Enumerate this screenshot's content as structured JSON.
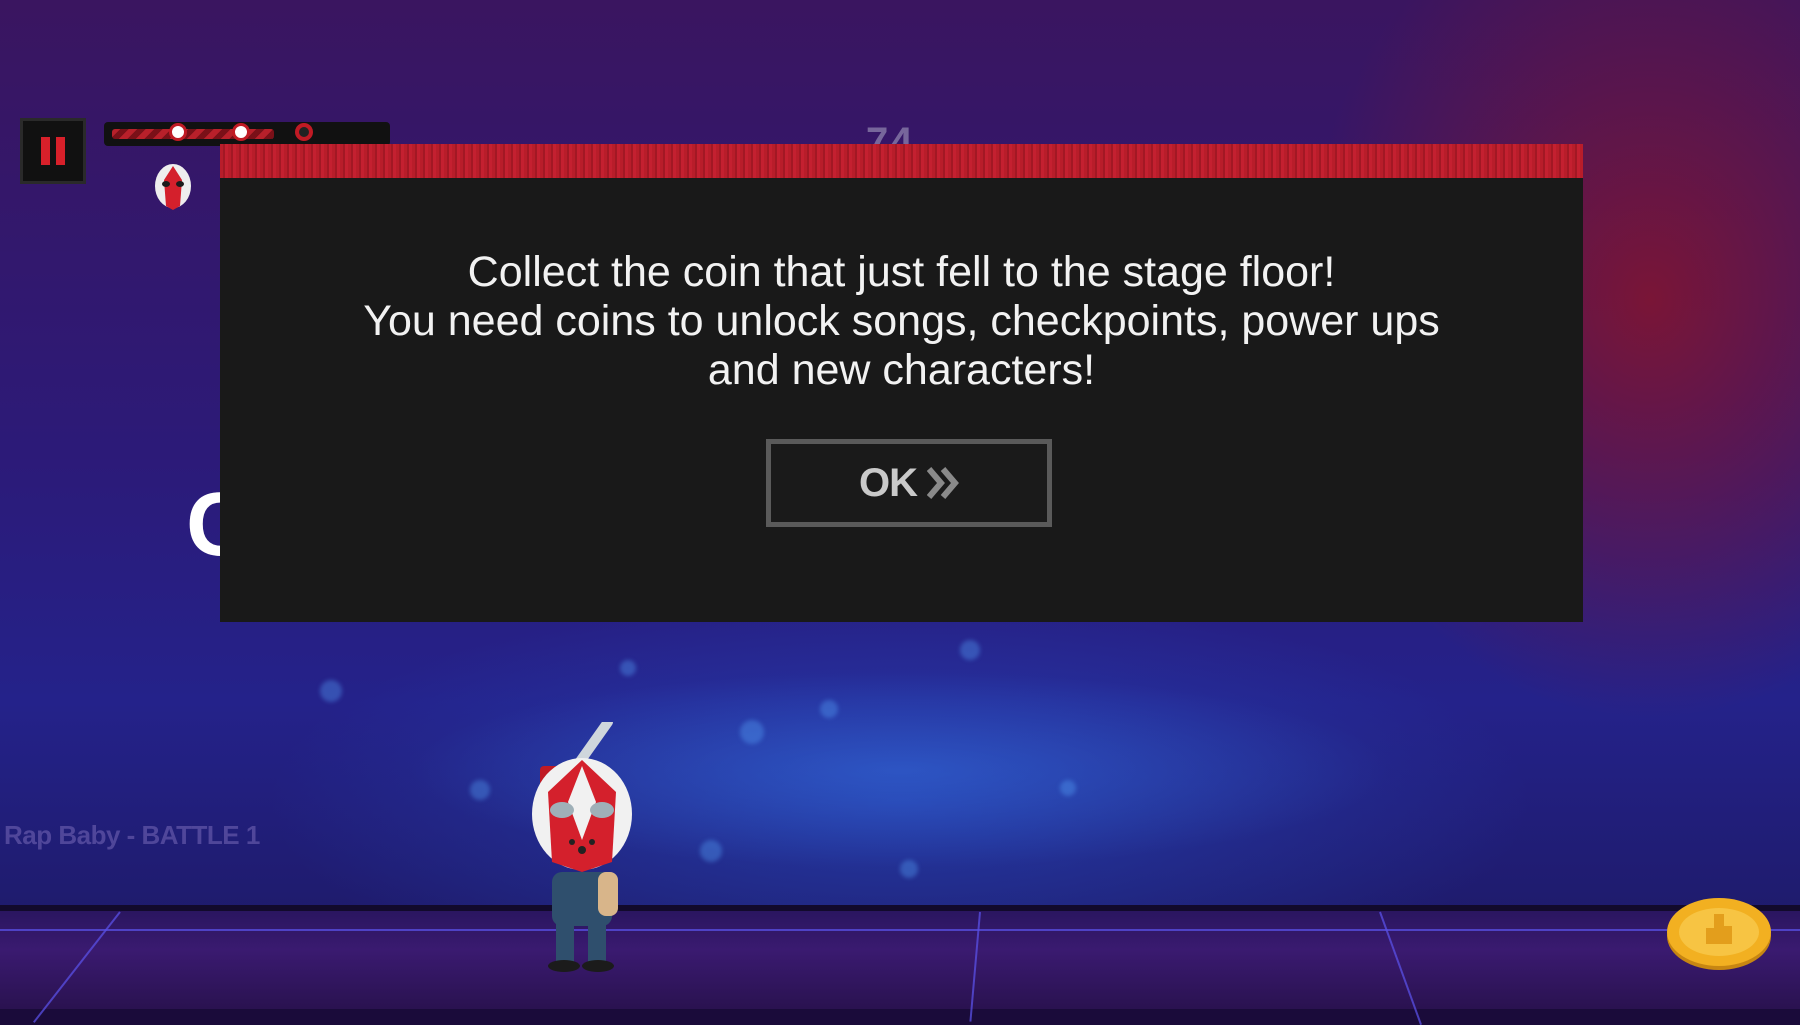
{
  "hud": {
    "pause_label": "Pause",
    "progress": 0.6,
    "checkpoints": [
      {
        "position": 0.23,
        "reached": true
      },
      {
        "position": 0.45,
        "reached": true
      },
      {
        "position": 0.67,
        "reached": false
      }
    ]
  },
  "background": {
    "score_text": "74",
    "partial_letter": "C",
    "song_label": "Rap Baby - BATTLE 1"
  },
  "dialog": {
    "message": "Collect the coin that just fell to the stage floor!\nYou need coins to unlock songs, checkpoints, power ups\nand new characters!",
    "ok_label": "OK"
  },
  "colors": {
    "accent_red": "#c01a24",
    "dialog_bg": "#191919",
    "coin_gold": "#f2b021"
  },
  "icons": {
    "pause": "pause-icon",
    "ok_chevrons": "double-chevron-right-icon",
    "coin": "coin-icon",
    "player_marker": "masked-face-icon"
  }
}
